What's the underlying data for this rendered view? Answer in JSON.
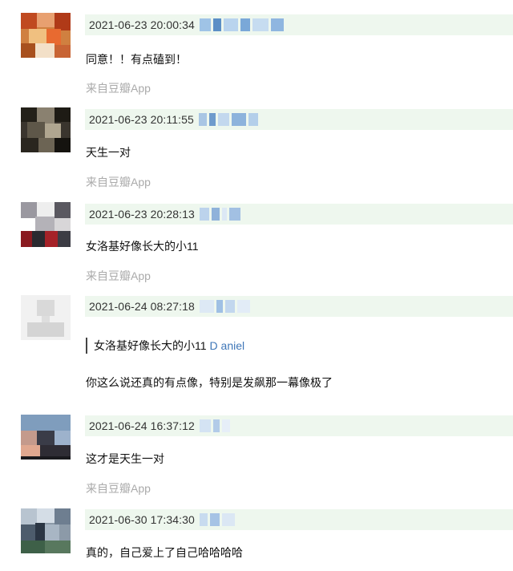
{
  "comments": [
    {
      "time": "2021-06-23 20:00:34",
      "text": "同意！！有点磕到！",
      "source": "来自豆瓣App"
    },
    {
      "time": "2021-06-23 20:11:55",
      "text": "天生一对",
      "source": "来自豆瓣App"
    },
    {
      "time": "2021-06-23 20:28:13",
      "text": "女洛基好像长大的小11",
      "source": "来自豆瓣App"
    },
    {
      "time": "2021-06-24 08:27:18",
      "quote_text": "女洛基好像长大的小11",
      "quote_author": "D aniel",
      "text": "你这么说还真的有点像，特别是发飙那一幕像极了"
    },
    {
      "time": "2021-06-24 16:37:12",
      "text": "这才是天生一对",
      "source": "来自豆瓣App"
    },
    {
      "time": "2021-06-30 17:34:30",
      "text": "真的，自己爱上了自己哈哈哈哈"
    }
  ],
  "colors": {
    "meta_bg": "#eef7ee",
    "link": "#3f77b8",
    "source": "#aaaaaa"
  },
  "icons": {
    "avatar": "blurred-user-avatar",
    "username": "blurred-username"
  }
}
